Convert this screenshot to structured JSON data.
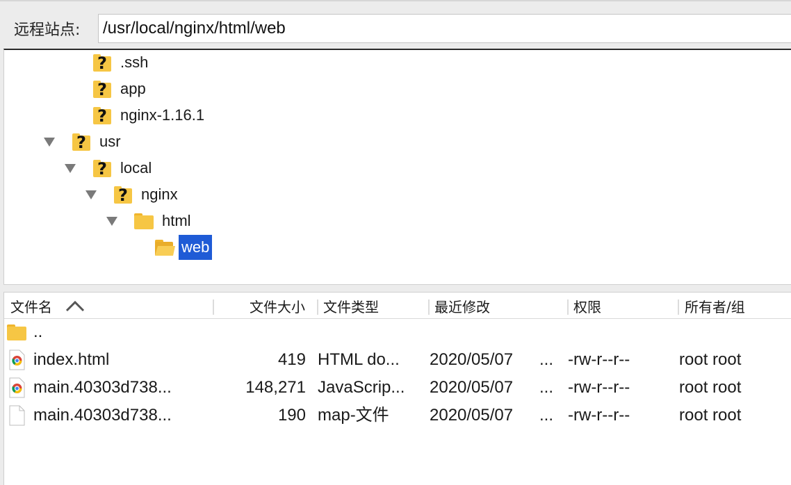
{
  "path_bar": {
    "label": "远程站点:",
    "path": "/usr/local/nginx/html/web"
  },
  "tree": [
    {
      "label": ".ssh",
      "icon": "unknown-folder-icon",
      "expanded": false
    },
    {
      "label": "app",
      "icon": "unknown-folder-icon",
      "expanded": false
    },
    {
      "label": "nginx-1.16.1",
      "icon": "unknown-folder-icon",
      "expanded": false
    },
    {
      "label": "usr",
      "icon": "unknown-folder-icon",
      "expanded": true
    },
    {
      "label": "local",
      "icon": "unknown-folder-icon",
      "expanded": true
    },
    {
      "label": "nginx",
      "icon": "unknown-folder-icon",
      "expanded": true
    },
    {
      "label": "html",
      "icon": "folder-icon",
      "expanded": true
    },
    {
      "label": "web",
      "icon": "folder-open-icon",
      "selected": true
    }
  ],
  "columns": {
    "name": "文件名",
    "size": "文件大小",
    "type": "文件类型",
    "modified": "最近修改",
    "perms": "权限",
    "owner": "所有者/组"
  },
  "sort": {
    "column": "name",
    "direction": "ascending",
    "icon": "sort-ascending-icon"
  },
  "files": [
    {
      "name": "..",
      "size": "",
      "type": "",
      "modified": "",
      "modified_more": "",
      "perms": "",
      "owner": "",
      "icon": "folder-icon"
    },
    {
      "name": "index.html",
      "size": "419",
      "type": "HTML do...",
      "modified": "2020/05/07",
      "modified_more": "...",
      "perms": "-rw-r--r--",
      "owner": "root root",
      "icon": "chrome-document-icon"
    },
    {
      "name": "main.40303d738...",
      "size": "148,271",
      "type": "JavaScrip...",
      "modified": "2020/05/07",
      "modified_more": "...",
      "perms": "-rw-r--r--",
      "owner": "root root",
      "icon": "chrome-document-icon"
    },
    {
      "name": "main.40303d738...",
      "size": "190",
      "type": "map-文件",
      "modified": "2020/05/07",
      "modified_more": "...",
      "perms": "-rw-r--r--",
      "owner": "root root",
      "icon": "blank-document-icon"
    }
  ],
  "colors": {
    "selection": "#1f5bd6",
    "folder": "#f6c644",
    "panel_bg": "#ffffff",
    "chrome_bg": "#ececec"
  }
}
